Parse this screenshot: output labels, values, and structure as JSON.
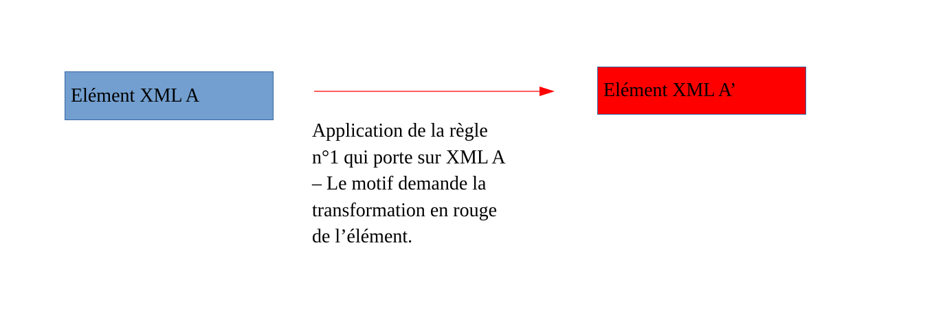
{
  "diagram": {
    "source": {
      "label": "Elément XML A",
      "fill": "#729fcf"
    },
    "result": {
      "label": "Elément XML A’",
      "fill": "#ff0000"
    },
    "arrow": {
      "color": "#ff0000"
    },
    "caption": {
      "lines": [
        "Application de la règle",
        "n°1 qui porte sur XML A",
        "– Le motif demande la",
        "transformation en rouge",
        "de l’élément."
      ]
    }
  }
}
